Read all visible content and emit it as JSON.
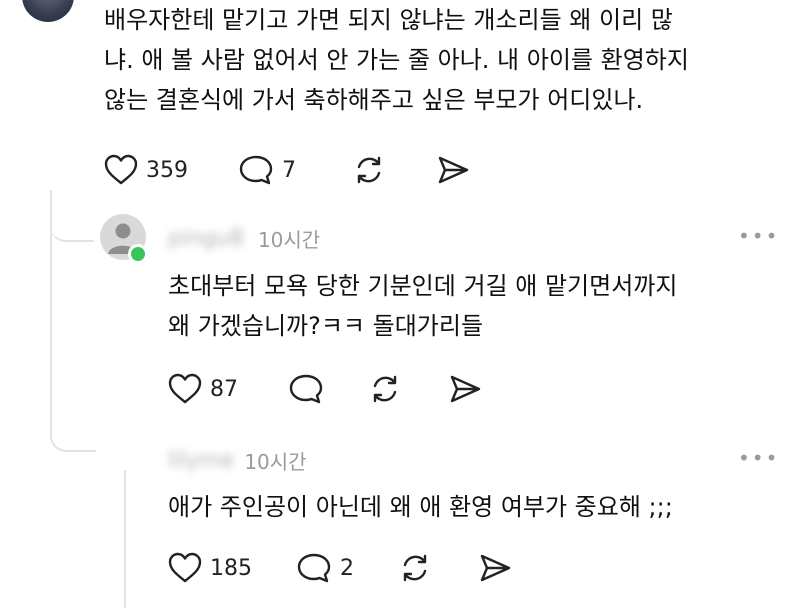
{
  "comment_main": {
    "lines": [
      "배우자한테 맡기고 가면 되지 않냐는 개소리들 왜 이리 많",
      "냐. 애 볼 사람 없어서 안 가는 줄 아나. 내 아이를 환영하지",
      "않는 결혼식에 가서 축하해주고 싶은 부모가 어디있나."
    ],
    "likes": "359",
    "replies": "7"
  },
  "reply_1": {
    "username": "pingu8",
    "time": "10시간",
    "lines": [
      "초대부터 모욕 당한 기분인데 거길 애 맡기면서까지",
      "왜 가겠습니까?ㅋㅋ 돌대가리들"
    ],
    "likes": "87"
  },
  "reply_2": {
    "username": "lilyme",
    "time": "10시간",
    "lines": [
      "애가 주인공이 아닌데 왜 애 환영 여부가 중요해 ;;;"
    ],
    "likes": "185",
    "replies": "2"
  },
  "more_label": "•••",
  "colors": {
    "online": "#3ac55b",
    "meta": "#9a9a9a",
    "line": "#e2e2e2"
  }
}
